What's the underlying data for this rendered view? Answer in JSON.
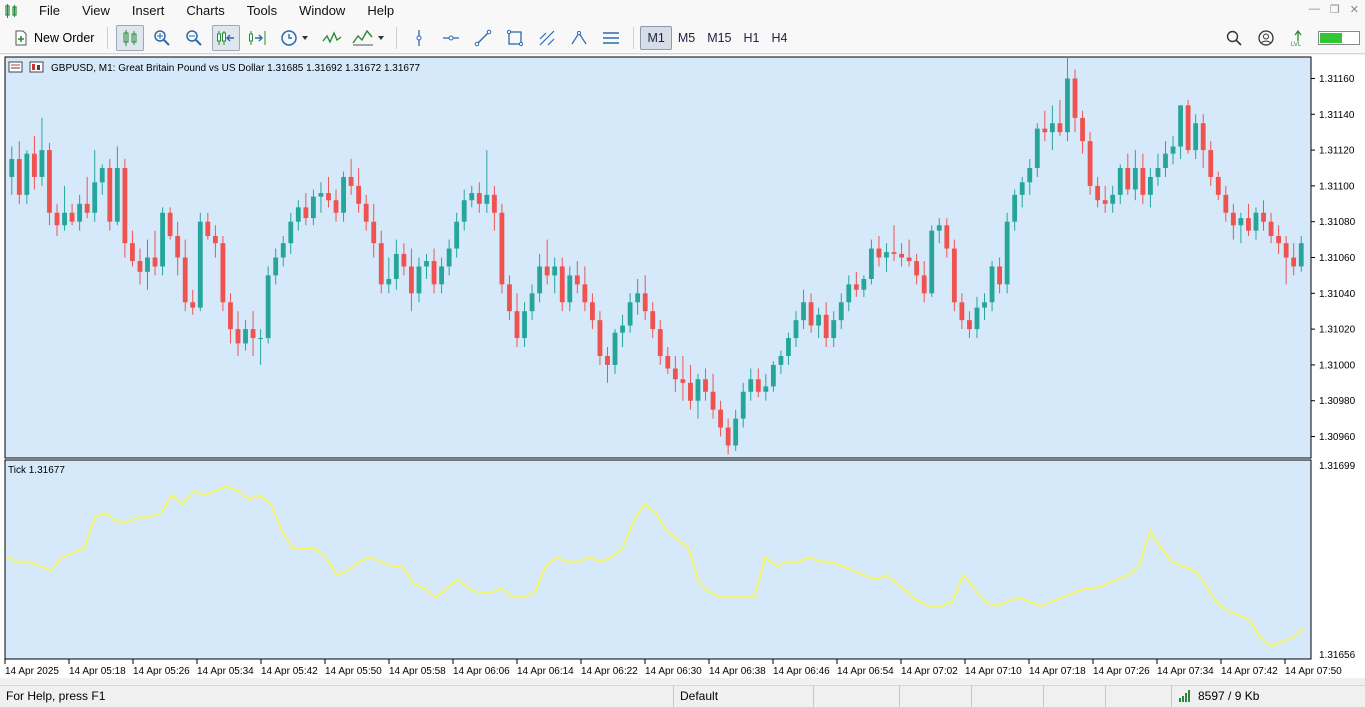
{
  "menu": {
    "items": [
      "File",
      "View",
      "Insert",
      "Charts",
      "Tools",
      "Window",
      "Help"
    ]
  },
  "toolbar": {
    "new_order_label": "New Order",
    "timeframes": [
      "M1",
      "M5",
      "M15",
      "H1",
      "H4"
    ],
    "active_timeframe": "M1"
  },
  "chart": {
    "header": "GBPUSD, M1:  Great Britain Pound vs US Dollar  1.31685 1.31692 1.31672 1.31677",
    "background": "#d6e9fb",
    "bull_color": "#26a69a",
    "bear_color": "#ef5350",
    "price_axis": [
      "1.31160",
      "1.31140",
      "1.31120",
      "1.31100",
      "1.31080",
      "1.31060",
      "1.31040",
      "1.31020",
      "1.31000",
      "1.30980",
      "1.30960"
    ],
    "indicator_label": "Tick 1.31677",
    "indicator_axis_top": "1.31699",
    "indicator_axis_bottom": "1.31656",
    "indicator_color": "#f5f56a",
    "time_axis": [
      "14 Apr 2025",
      "14 Apr 05:18",
      "14 Apr 05:26",
      "14 Apr 05:34",
      "14 Apr 05:42",
      "14 Apr 05:50",
      "14 Apr 05:58",
      "14 Apr 06:06",
      "14 Apr 06:14",
      "14 Apr 06:22",
      "14 Apr 06:30",
      "14 Apr 06:38",
      "14 Apr 06:46",
      "14 Apr 06:54",
      "14 Apr 07:02",
      "14 Apr 07:10",
      "14 Apr 07:18",
      "14 Apr 07:26",
      "14 Apr 07:34",
      "14 Apr 07:42",
      "14 Apr 07:50"
    ]
  },
  "chart_data": {
    "type": "candlestick",
    "price_range": [
      1.30948,
      1.31172
    ],
    "candles": [
      [
        1.31105,
        1.31122,
        1.31095,
        1.31115
      ],
      [
        1.31115,
        1.31125,
        1.3109,
        1.31095
      ],
      [
        1.31095,
        1.3112,
        1.3109,
        1.31118
      ],
      [
        1.31118,
        1.31128,
        1.31098,
        1.31105
      ],
      [
        1.31105,
        1.31138,
        1.311,
        1.3112
      ],
      [
        1.3112,
        1.31124,
        1.31078,
        1.31085
      ],
      [
        1.31085,
        1.3109,
        1.31072,
        1.31078
      ],
      [
        1.31078,
        1.311,
        1.31075,
        1.31085
      ],
      [
        1.31085,
        1.3109,
        1.31078,
        1.3108
      ],
      [
        1.3108,
        1.31095,
        1.31075,
        1.3109
      ],
      [
        1.3109,
        1.31105,
        1.31082,
        1.31085
      ],
      [
        1.31085,
        1.3112,
        1.3108,
        1.31102
      ],
      [
        1.31102,
        1.31112,
        1.31095,
        1.3111
      ],
      [
        1.3111,
        1.31115,
        1.31075,
        1.3108
      ],
      [
        1.3108,
        1.31122,
        1.31078,
        1.3111
      ],
      [
        1.3111,
        1.31115,
        1.3106,
        1.31068
      ],
      [
        1.31068,
        1.31075,
        1.31055,
        1.31058
      ],
      [
        1.31058,
        1.31065,
        1.31045,
        1.31052
      ],
      [
        1.31052,
        1.3107,
        1.31042,
        1.3106
      ],
      [
        1.3106,
        1.31075,
        1.3105,
        1.31055
      ],
      [
        1.31055,
        1.31088,
        1.3105,
        1.31085
      ],
      [
        1.31085,
        1.31088,
        1.3107,
        1.31072
      ],
      [
        1.31072,
        1.3108,
        1.3105,
        1.3106
      ],
      [
        1.3106,
        1.3107,
        1.3103,
        1.31035
      ],
      [
        1.31035,
        1.31042,
        1.31028,
        1.31032
      ],
      [
        1.31032,
        1.31085,
        1.3103,
        1.3108
      ],
      [
        1.3108,
        1.31085,
        1.3107,
        1.31072
      ],
      [
        1.31072,
        1.31078,
        1.3106,
        1.31068
      ],
      [
        1.31068,
        1.31072,
        1.3103,
        1.31035
      ],
      [
        1.31035,
        1.3104,
        1.31012,
        1.3102
      ],
      [
        1.3102,
        1.3103,
        1.31005,
        1.31012
      ],
      [
        1.31012,
        1.31025,
        1.31008,
        1.3102
      ],
      [
        1.3102,
        1.3103,
        1.31005,
        1.31015
      ],
      [
        1.31015,
        1.3102,
        1.31,
        1.31015
      ],
      [
        1.31015,
        1.31055,
        1.31012,
        1.3105
      ],
      [
        1.3105,
        1.31065,
        1.31045,
        1.3106
      ],
      [
        1.3106,
        1.31072,
        1.31055,
        1.31068
      ],
      [
        1.31068,
        1.31085,
        1.31062,
        1.3108
      ],
      [
        1.3108,
        1.31092,
        1.31075,
        1.31088
      ],
      [
        1.31088,
        1.31096,
        1.31078,
        1.31082
      ],
      [
        1.31082,
        1.31098,
        1.31078,
        1.31094
      ],
      [
        1.31094,
        1.31102,
        1.31085,
        1.31096
      ],
      [
        1.31096,
        1.31105,
        1.31088,
        1.31092
      ],
      [
        1.31092,
        1.31098,
        1.3108,
        1.31085
      ],
      [
        1.31085,
        1.31108,
        1.3108,
        1.31105
      ],
      [
        1.31105,
        1.31115,
        1.31095,
        1.311
      ],
      [
        1.311,
        1.3111,
        1.31085,
        1.3109
      ],
      [
        1.3109,
        1.31095,
        1.31075,
        1.3108
      ],
      [
        1.3108,
        1.3109,
        1.3106,
        1.31068
      ],
      [
        1.31068,
        1.31075,
        1.3104,
        1.31045
      ],
      [
        1.31045,
        1.3106,
        1.3104,
        1.31048
      ],
      [
        1.31048,
        1.3107,
        1.31042,
        1.31062
      ],
      [
        1.31062,
        1.31068,
        1.3105,
        1.31055
      ],
      [
        1.31055,
        1.31065,
        1.3103,
        1.3104
      ],
      [
        1.3104,
        1.3106,
        1.31035,
        1.31055
      ],
      [
        1.31055,
        1.31062,
        1.31048,
        1.31058
      ],
      [
        1.31058,
        1.31065,
        1.3104,
        1.31045
      ],
      [
        1.31045,
        1.3106,
        1.3104,
        1.31055
      ],
      [
        1.31055,
        1.3107,
        1.3105,
        1.31065
      ],
      [
        1.31065,
        1.31085,
        1.3106,
        1.3108
      ],
      [
        1.3108,
        1.31098,
        1.31075,
        1.31092
      ],
      [
        1.31092,
        1.311,
        1.31088,
        1.31096
      ],
      [
        1.31096,
        1.31102,
        1.31085,
        1.3109
      ],
      [
        1.3109,
        1.3112,
        1.31085,
        1.31095
      ],
      [
        1.31095,
        1.311,
        1.31075,
        1.31085
      ],
      [
        1.31085,
        1.3109,
        1.3104,
        1.31045
      ],
      [
        1.31045,
        1.3105,
        1.31025,
        1.3103
      ],
      [
        1.3103,
        1.3104,
        1.3101,
        1.31015
      ],
      [
        1.31015,
        1.31035,
        1.3101,
        1.3103
      ],
      [
        1.3103,
        1.31045,
        1.31025,
        1.3104
      ],
      [
        1.3104,
        1.31062,
        1.31035,
        1.31055
      ],
      [
        1.31055,
        1.3107,
        1.31045,
        1.3105
      ],
      [
        1.3105,
        1.3106,
        1.3104,
        1.31055
      ],
      [
        1.31055,
        1.3106,
        1.3103,
        1.31035
      ],
      [
        1.31035,
        1.31055,
        1.3103,
        1.3105
      ],
      [
        1.3105,
        1.31058,
        1.3104,
        1.31045
      ],
      [
        1.31045,
        1.31055,
        1.3103,
        1.31035
      ],
      [
        1.31035,
        1.3104,
        1.3102,
        1.31025
      ],
      [
        1.31025,
        1.3103,
        1.31,
        1.31005
      ],
      [
        1.31005,
        1.3101,
        1.3099,
        1.31
      ],
      [
        1.31,
        1.3102,
        1.30995,
        1.31018
      ],
      [
        1.31018,
        1.31028,
        1.3101,
        1.31022
      ],
      [
        1.31022,
        1.3104,
        1.31018,
        1.31035
      ],
      [
        1.31035,
        1.31048,
        1.31028,
        1.3104
      ],
      [
        1.3104,
        1.3105,
        1.31025,
        1.3103
      ],
      [
        1.3103,
        1.31035,
        1.31015,
        1.3102
      ],
      [
        1.3102,
        1.31025,
        1.31,
        1.31005
      ],
      [
        1.31005,
        1.3101,
        1.30995,
        1.30998
      ],
      [
        1.30998,
        1.31005,
        1.30985,
        1.30992
      ],
      [
        1.30992,
        1.31005,
        1.3098,
        1.3099
      ],
      [
        1.3099,
        1.31,
        1.30975,
        1.3098
      ],
      [
        1.3098,
        1.30995,
        1.3097,
        1.30992
      ],
      [
        1.30992,
        1.30998,
        1.3098,
        1.30985
      ],
      [
        1.30985,
        1.30995,
        1.3097,
        1.30975
      ],
      [
        1.30975,
        1.3098,
        1.3096,
        1.30965
      ],
      [
        1.30965,
        1.3097,
        1.3095,
        1.30955
      ],
      [
        1.30955,
        1.30975,
        1.30952,
        1.3097
      ],
      [
        1.3097,
        1.3099,
        1.30965,
        1.30985
      ],
      [
        1.30985,
        1.30998,
        1.3098,
        1.30992
      ],
      [
        1.30992,
        1.30998,
        1.30982,
        1.30985
      ],
      [
        1.30985,
        1.30995,
        1.3098,
        1.30988
      ],
      [
        1.30988,
        1.31002,
        1.30985,
        1.31
      ],
      [
        1.31,
        1.31008,
        1.30995,
        1.31005
      ],
      [
        1.31005,
        1.31018,
        1.31,
        1.31015
      ],
      [
        1.31015,
        1.3103,
        1.3101,
        1.31025
      ],
      [
        1.31025,
        1.31042,
        1.3102,
        1.31035
      ],
      [
        1.31035,
        1.3104,
        1.31018,
        1.31022
      ],
      [
        1.31022,
        1.31032,
        1.31015,
        1.31028
      ],
      [
        1.31028,
        1.31035,
        1.3101,
        1.31015
      ],
      [
        1.31015,
        1.3103,
        1.3101,
        1.31025
      ],
      [
        1.31025,
        1.3104,
        1.3102,
        1.31035
      ],
      [
        1.31035,
        1.3105,
        1.3103,
        1.31045
      ],
      [
        1.31045,
        1.31052,
        1.31038,
        1.31042
      ],
      [
        1.31042,
        1.3105,
        1.31038,
        1.31048
      ],
      [
        1.31048,
        1.3107,
        1.31045,
        1.31065
      ],
      [
        1.31065,
        1.31072,
        1.31055,
        1.3106
      ],
      [
        1.3106,
        1.31068,
        1.31052,
        1.31063
      ],
      [
        1.31063,
        1.31078,
        1.31058,
        1.31062
      ],
      [
        1.31062,
        1.31068,
        1.31055,
        1.3106
      ],
      [
        1.3106,
        1.3107,
        1.31055,
        1.31058
      ],
      [
        1.31058,
        1.31062,
        1.31045,
        1.3105
      ],
      [
        1.3105,
        1.31058,
        1.31035,
        1.3104
      ],
      [
        1.3104,
        1.31078,
        1.31038,
        1.31075
      ],
      [
        1.31075,
        1.31082,
        1.31068,
        1.31078
      ],
      [
        1.31078,
        1.31082,
        1.3106,
        1.31065
      ],
      [
        1.31065,
        1.3107,
        1.3103,
        1.31035
      ],
      [
        1.31035,
        1.3104,
        1.3102,
        1.31025
      ],
      [
        1.31025,
        1.3103,
        1.31015,
        1.3102
      ],
      [
        1.3102,
        1.31038,
        1.31015,
        1.31032
      ],
      [
        1.31032,
        1.3104,
        1.31025,
        1.31035
      ],
      [
        1.31035,
        1.31058,
        1.3103,
        1.31055
      ],
      [
        1.31055,
        1.3106,
        1.3104,
        1.31045
      ],
      [
        1.31045,
        1.31085,
        1.3104,
        1.3108
      ],
      [
        1.3108,
        1.31098,
        1.31075,
        1.31095
      ],
      [
        1.31095,
        1.31105,
        1.31088,
        1.31102
      ],
      [
        1.31102,
        1.31115,
        1.31095,
        1.3111
      ],
      [
        1.3111,
        1.31135,
        1.31105,
        1.31132
      ],
      [
        1.31132,
        1.31142,
        1.31125,
        1.3113
      ],
      [
        1.3113,
        1.31145,
        1.3112,
        1.31135
      ],
      [
        1.31135,
        1.31148,
        1.31128,
        1.3113
      ],
      [
        1.3113,
        1.31172,
        1.31125,
        1.3116
      ],
      [
        1.3116,
        1.31165,
        1.3113,
        1.31138
      ],
      [
        1.31138,
        1.31142,
        1.31118,
        1.31125
      ],
      [
        1.31125,
        1.3113,
        1.31095,
        1.311
      ],
      [
        1.311,
        1.31105,
        1.31088,
        1.31092
      ],
      [
        1.31092,
        1.311,
        1.31085,
        1.3109
      ],
      [
        1.3109,
        1.311,
        1.31085,
        1.31095
      ],
      [
        1.31095,
        1.31112,
        1.3109,
        1.3111
      ],
      [
        1.3111,
        1.31118,
        1.31095,
        1.31098
      ],
      [
        1.31098,
        1.3112,
        1.31092,
        1.3111
      ],
      [
        1.3111,
        1.31118,
        1.3109,
        1.31095
      ],
      [
        1.31095,
        1.3111,
        1.31088,
        1.31105
      ],
      [
        1.31105,
        1.31118,
        1.311,
        1.3111
      ],
      [
        1.3111,
        1.31125,
        1.31105,
        1.31118
      ],
      [
        1.31118,
        1.31128,
        1.31112,
        1.31122
      ],
      [
        1.31122,
        1.31145,
        1.31115,
        1.31145
      ],
      [
        1.31145,
        1.31148,
        1.31118,
        1.3112
      ],
      [
        1.3112,
        1.3114,
        1.31115,
        1.31135
      ],
      [
        1.31135,
        1.3114,
        1.3111,
        1.3112
      ],
      [
        1.3112,
        1.31125,
        1.311,
        1.31105
      ],
      [
        1.31105,
        1.31108,
        1.31092,
        1.31095
      ],
      [
        1.31095,
        1.311,
        1.3108,
        1.31085
      ],
      [
        1.31085,
        1.3109,
        1.3107,
        1.31078
      ],
      [
        1.31078,
        1.31085,
        1.31068,
        1.31082
      ],
      [
        1.31082,
        1.3109,
        1.31072,
        1.31075
      ],
      [
        1.31075,
        1.31088,
        1.3107,
        1.31085
      ],
      [
        1.31085,
        1.31092,
        1.31075,
        1.3108
      ],
      [
        1.3108,
        1.31085,
        1.31068,
        1.31072
      ],
      [
        1.31072,
        1.31078,
        1.31062,
        1.31068
      ],
      [
        1.31068,
        1.31072,
        1.31045,
        1.3106
      ],
      [
        1.3106,
        1.31068,
        1.3105,
        1.31055
      ],
      [
        1.31055,
        1.31072,
        1.31052,
        1.31068
      ]
    ],
    "tick_line": [
      1.31678,
      1.31677,
      1.31677,
      1.31676,
      1.31675,
      1.31678,
      1.31679,
      1.3168,
      1.31687,
      1.31688,
      1.31686,
      1.31686,
      1.31687,
      1.31687,
      1.31688,
      1.31692,
      1.3169,
      1.31693,
      1.31692,
      1.31693,
      1.31694,
      1.31693,
      1.31691,
      1.31692,
      1.3169,
      1.31684,
      1.3168,
      1.3168,
      1.3168,
      1.31678,
      1.31674,
      1.31675,
      1.31677,
      1.31678,
      1.31677,
      1.31676,
      1.31676,
      1.31672,
      1.31671,
      1.31669,
      1.31671,
      1.31673,
      1.31671,
      1.3167,
      1.3167,
      1.31671,
      1.31669,
      1.31669,
      1.3167,
      1.31676,
      1.31678,
      1.31677,
      1.31677,
      1.31678,
      1.31677,
      1.31678,
      1.3168,
      1.31686,
      1.3169,
      1.31688,
      1.31684,
      1.31682,
      1.3168,
      1.31672,
      1.3167,
      1.31669,
      1.31669,
      1.31669,
      1.31669,
      1.31678,
      1.31676,
      1.31677,
      1.31677,
      1.31678,
      1.31677,
      1.31677,
      1.31676,
      1.31675,
      1.31674,
      1.31673,
      1.31674,
      1.31672,
      1.3167,
      1.31668,
      1.31667,
      1.31667,
      1.31668,
      1.31674,
      1.31671,
      1.31668,
      1.31667,
      1.31668,
      1.31669,
      1.31668,
      1.31667,
      1.31668,
      1.31669,
      1.3167,
      1.31671,
      1.31671,
      1.31672,
      1.31673,
      1.31674,
      1.31676,
      1.31684,
      1.3168,
      1.31677,
      1.31676,
      1.31675,
      1.31672,
      1.31668,
      1.31666,
      1.31665,
      1.31664,
      1.3166,
      1.31658,
      1.31659,
      1.3166,
      1.31662
    ]
  },
  "status": {
    "help": "For Help, press F1",
    "profile": "Default",
    "traffic": "8597 / 9 Kb"
  },
  "icons": [
    "new-order-icon",
    "bar-chart-icon",
    "candles-icon",
    "line-chart-icon",
    "zoom-in-icon",
    "zoom-out-icon",
    "autoscroll-icon",
    "chart-shift-icon",
    "clock-icon",
    "indicators-icon",
    "vertical-line-icon",
    "horizontal-line-icon",
    "trendline-icon",
    "rectangle-icon",
    "fibonacci-icon",
    "channel-icon",
    "menu-icon",
    "search-icon",
    "account-icon",
    "signal-icon"
  ]
}
